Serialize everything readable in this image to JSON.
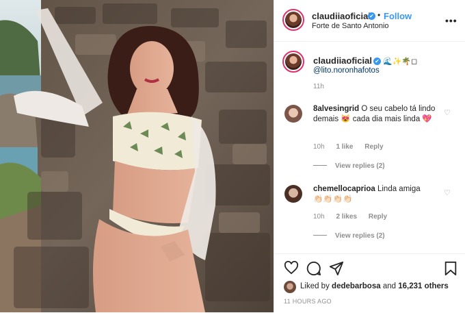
{
  "post": {
    "username": "claudiiaoficial",
    "verified_mark": "✔",
    "dot": "•",
    "follow_label": "Follow",
    "location": "Forte de Santo Antonio",
    "more_icon": "more-dots-icon",
    "more_glyph": "•••"
  },
  "caption": {
    "username": "claudiiaoficial",
    "emojis": "🌊✨🌴◻",
    "mention": "@lito.noronhafotos",
    "time": "11h"
  },
  "comments": [
    {
      "username": "8alvesingrid",
      "text": "O seu cabelo tá lindo demais 😻 cada dia mais linda 💖",
      "time": "10h",
      "likes": "1 like",
      "reply_label": "Reply",
      "view_replies": "View replies (2)"
    },
    {
      "username": "chemellocaprioa",
      "text": "Linda amiga",
      "text_line2": "👏🏻👏🏻👏🏻👏🏻",
      "time": "10h",
      "likes": "2 likes",
      "reply_label": "Reply",
      "view_replies": "View replies (2)"
    }
  ],
  "heart_glyph": "♡",
  "likes": {
    "prefix": "Liked by",
    "user": "dedebarbosa",
    "joiner": "and",
    "others": "16,231 others"
  },
  "timestamp": "11 HOURS AGO",
  "colors": {
    "link_blue": "#3897f0",
    "mention_blue": "#003569",
    "muted_gray": "#8e8e8e",
    "text": "#262626"
  }
}
